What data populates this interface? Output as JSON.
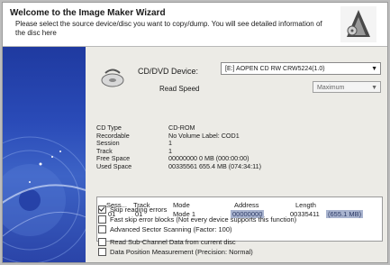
{
  "header": {
    "title": "Welcome to the Image Maker Wizard",
    "description": "Please select the source device/disc you want to copy/dump. You will see detailed information of the disc here"
  },
  "device": {
    "label": "CD/DVD Device:",
    "selected": "[E:] AOPEN CD RW CRW5224(1.0)",
    "read_speed_label": "Read Speed",
    "read_speed_value": "Maximum"
  },
  "disc_info": [
    {
      "key": "CD Type",
      "value": "CD-ROM"
    },
    {
      "key": "Recordable",
      "value": "No    Volume Label: COD1"
    },
    {
      "key": "Session",
      "value": "1"
    },
    {
      "key": "Track",
      "value": "1"
    },
    {
      "key": "Free Space",
      "value": "00000000   0 MB   (000:00:00)"
    },
    {
      "key": "Used Space",
      "value": "00335561   655.4 MB   (074:34:11)"
    }
  ],
  "tracks": {
    "columns": [
      "Sess...",
      "Track",
      "Mode",
      "Address",
      "Length"
    ],
    "rows": [
      {
        "session": "01",
        "track": "01",
        "mode": "Mode 1",
        "address": "00000000",
        "length": "00335411",
        "length_highlight": "(655.1 MB)"
      }
    ]
  },
  "options": [
    {
      "label": "Skip reading errors",
      "checked": true
    },
    {
      "label": "Fast skip error blocks (Not every device supports this function)",
      "checked": false
    },
    {
      "label": "Advanced Sector Scanning (Factor: 100)",
      "checked": false
    },
    {
      "label": "Read Sub-Channel Data from current disc",
      "checked": false
    },
    {
      "label": "Data Position Measurement (Precision: Normal)",
      "checked": false
    }
  ],
  "colors": {
    "sidebar_blue": "#2a4bb8",
    "highlight": "#a9b4cf"
  },
  "icons": {
    "logo": "wizard-logo-icon",
    "drive": "optical-drive-icon",
    "sidebar": "cd-disc-icon"
  }
}
